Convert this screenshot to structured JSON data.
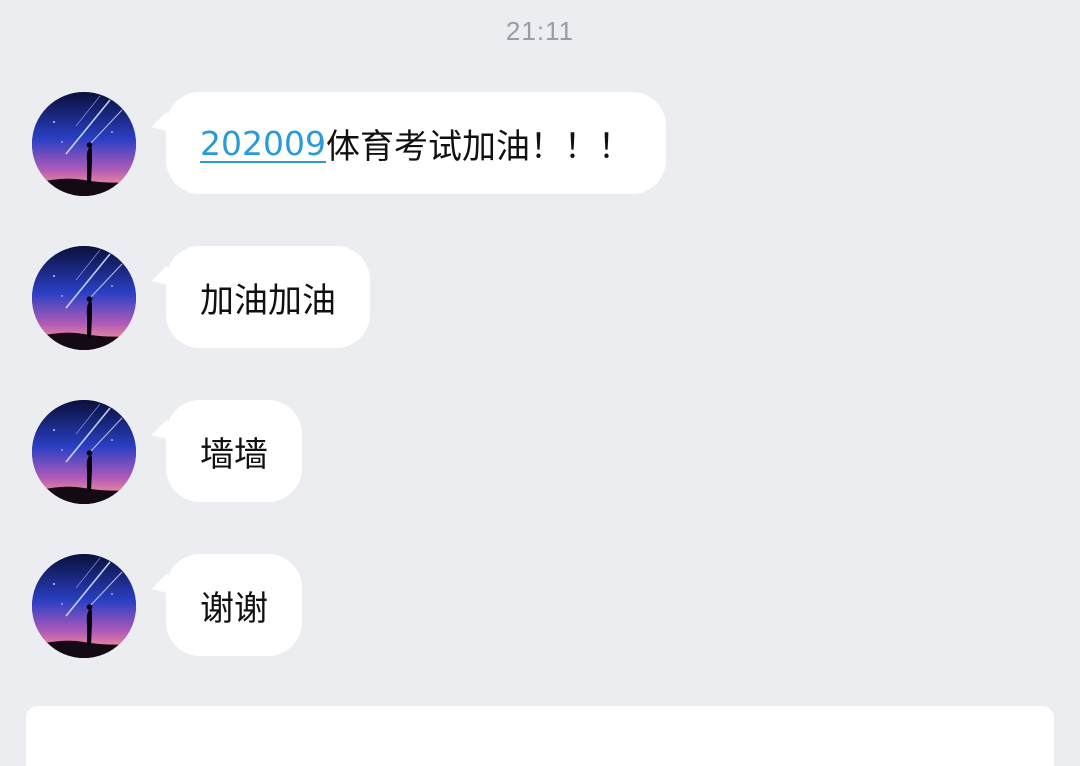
{
  "timestamp": "21:11",
  "messages": [
    {
      "link": "202009",
      "text": "体育考试加油！！！"
    },
    {
      "link": "",
      "text": "加油加油"
    },
    {
      "link": "",
      "text": "墙墙"
    },
    {
      "link": "",
      "text": "谢谢"
    }
  ],
  "colors": {
    "background": "#ebedf0",
    "bubble": "#ffffff",
    "link": "#2a9bd6",
    "timestamp": "#9a9ca1"
  },
  "icons": {
    "avatar": "avatar-starry-night-silhouette"
  }
}
